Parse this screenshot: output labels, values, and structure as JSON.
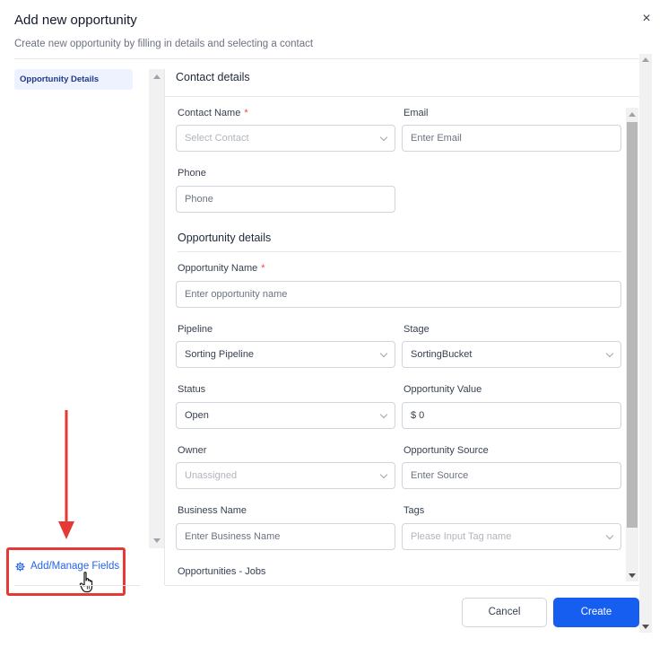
{
  "header": {
    "title": "Add new opportunity",
    "subtitle": "Create new opportunity by filling in details and selecting a contact",
    "close_icon": "×"
  },
  "sidebar": {
    "items": [
      {
        "label": "Opportunity Details",
        "active": true
      }
    ],
    "manage_fields_label": "Add/Manage Fields",
    "manage_fields_icon": "gear-icon"
  },
  "contact_section": {
    "title": "Contact details",
    "contact_name": {
      "label": "Contact Name",
      "required_mark": "*",
      "placeholder": "Select Contact"
    },
    "email": {
      "label": "Email",
      "placeholder": "Enter Email"
    },
    "phone": {
      "label": "Phone",
      "placeholder": "Phone"
    }
  },
  "opportunity_section": {
    "title": "Opportunity details",
    "name": {
      "label": "Opportunity Name",
      "required_mark": "*",
      "placeholder": "Enter opportunity name"
    },
    "pipeline": {
      "label": "Pipeline",
      "value": "Sorting Pipeline"
    },
    "stage": {
      "label": "Stage",
      "value": "SortingBucket"
    },
    "status": {
      "label": "Status",
      "value": "Open"
    },
    "value": {
      "label": "Opportunity Value",
      "value": "$ 0"
    },
    "owner": {
      "label": "Owner",
      "placeholder": "Unassigned"
    },
    "source": {
      "label": "Opportunity Source",
      "placeholder": "Enter Source"
    },
    "business_name": {
      "label": "Business Name",
      "placeholder": "Enter Business Name"
    },
    "tags": {
      "label": "Tags",
      "placeholder": "Please Input Tag name"
    },
    "jobs_label": "Opportunities - Jobs"
  },
  "footer": {
    "cancel_label": "Cancel",
    "create_label": "Create"
  },
  "colors": {
    "primary": "#155eef",
    "link": "#2563eb",
    "annotation_red": "#e53935",
    "required": "#ef4444"
  }
}
